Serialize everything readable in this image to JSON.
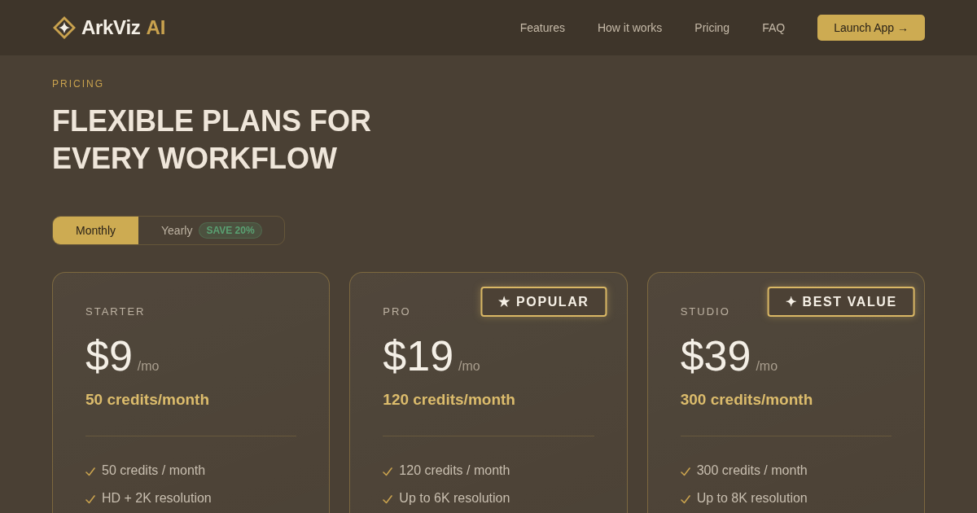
{
  "header": {
    "brand": {
      "name": "ArkViz",
      "suffix": "AI"
    },
    "nav": [
      "Features",
      "How it works",
      "Pricing",
      "FAQ"
    ],
    "cta": "Launch App →"
  },
  "hero": {
    "eyebrow": "PRICING",
    "title": "FLEXIBLE PLANS FOR EVERY WORKFLOW"
  },
  "billing_toggle": [
    {
      "label": "Monthly",
      "selected": true
    },
    {
      "label": "Yearly",
      "selected": false,
      "badge": "SAVE 20%"
    }
  ],
  "plans": [
    {
      "tier": "STARTER",
      "price": "$9",
      "period": "/mo",
      "credits": "50 credits/month",
      "features": [
        "50 credits / month",
        "HD + 2K resolution"
      ]
    },
    {
      "tier": "PRO",
      "badge": "★ POPULAR",
      "price": "$19",
      "period": "/mo",
      "credits": "120 credits/month",
      "features": [
        "120 credits / month",
        "Up to 6K resolution"
      ]
    },
    {
      "tier": "STUDIO",
      "badge": "✦ BEST VALUE",
      "price": "$39",
      "period": "/mo",
      "credits": "300 credits/month",
      "features": [
        "300 credits / month",
        "Up to 8K resolution"
      ]
    }
  ]
}
